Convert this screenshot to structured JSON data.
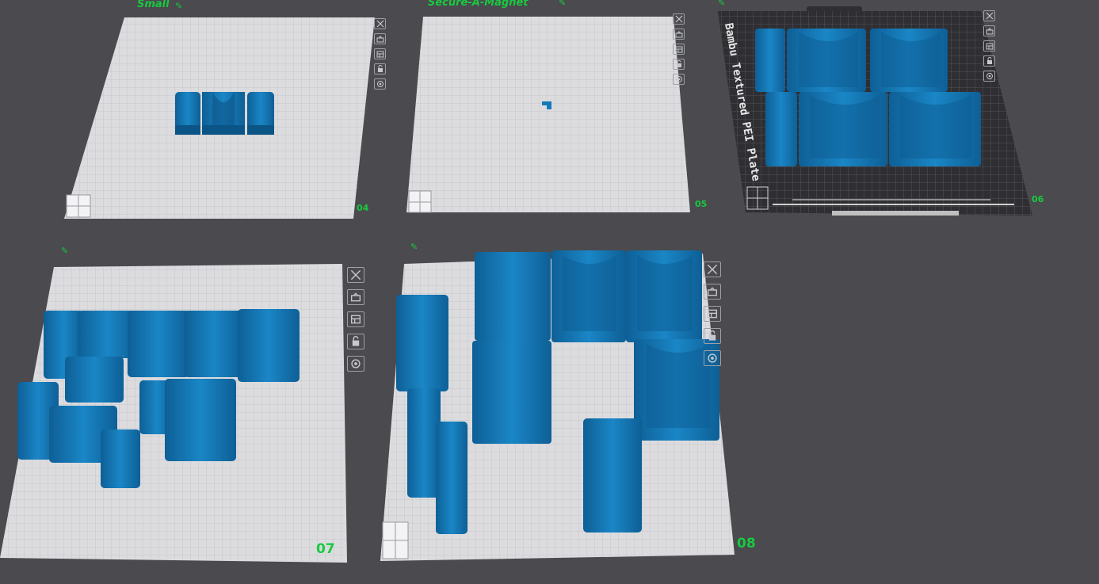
{
  "plates": [
    {
      "id": "plate-04",
      "name": "Small",
      "number": "04"
    },
    {
      "id": "plate-05",
      "name": "Secure-A-Magnet",
      "number": "05"
    },
    {
      "id": "plate-06",
      "name": "",
      "number": "06",
      "bed_label": "Bambu Textured PEI Plate"
    },
    {
      "id": "plate-07",
      "name": "",
      "number": "07"
    },
    {
      "id": "plate-08",
      "name": "",
      "number": "08"
    }
  ],
  "plate_tools": [
    "close-icon",
    "auto-orient-icon",
    "arrange-icon",
    "lock-icon",
    "settings-icon"
  ],
  "edit_icon": "✎",
  "colors": {
    "background": "#4a4a4f",
    "plate": "#d9d9db",
    "grid": "#c2c3c7",
    "part": "#1479b8",
    "part_dark": "#0b5486",
    "accent": "#19c93f",
    "textured_plate": "#2f2f33"
  }
}
